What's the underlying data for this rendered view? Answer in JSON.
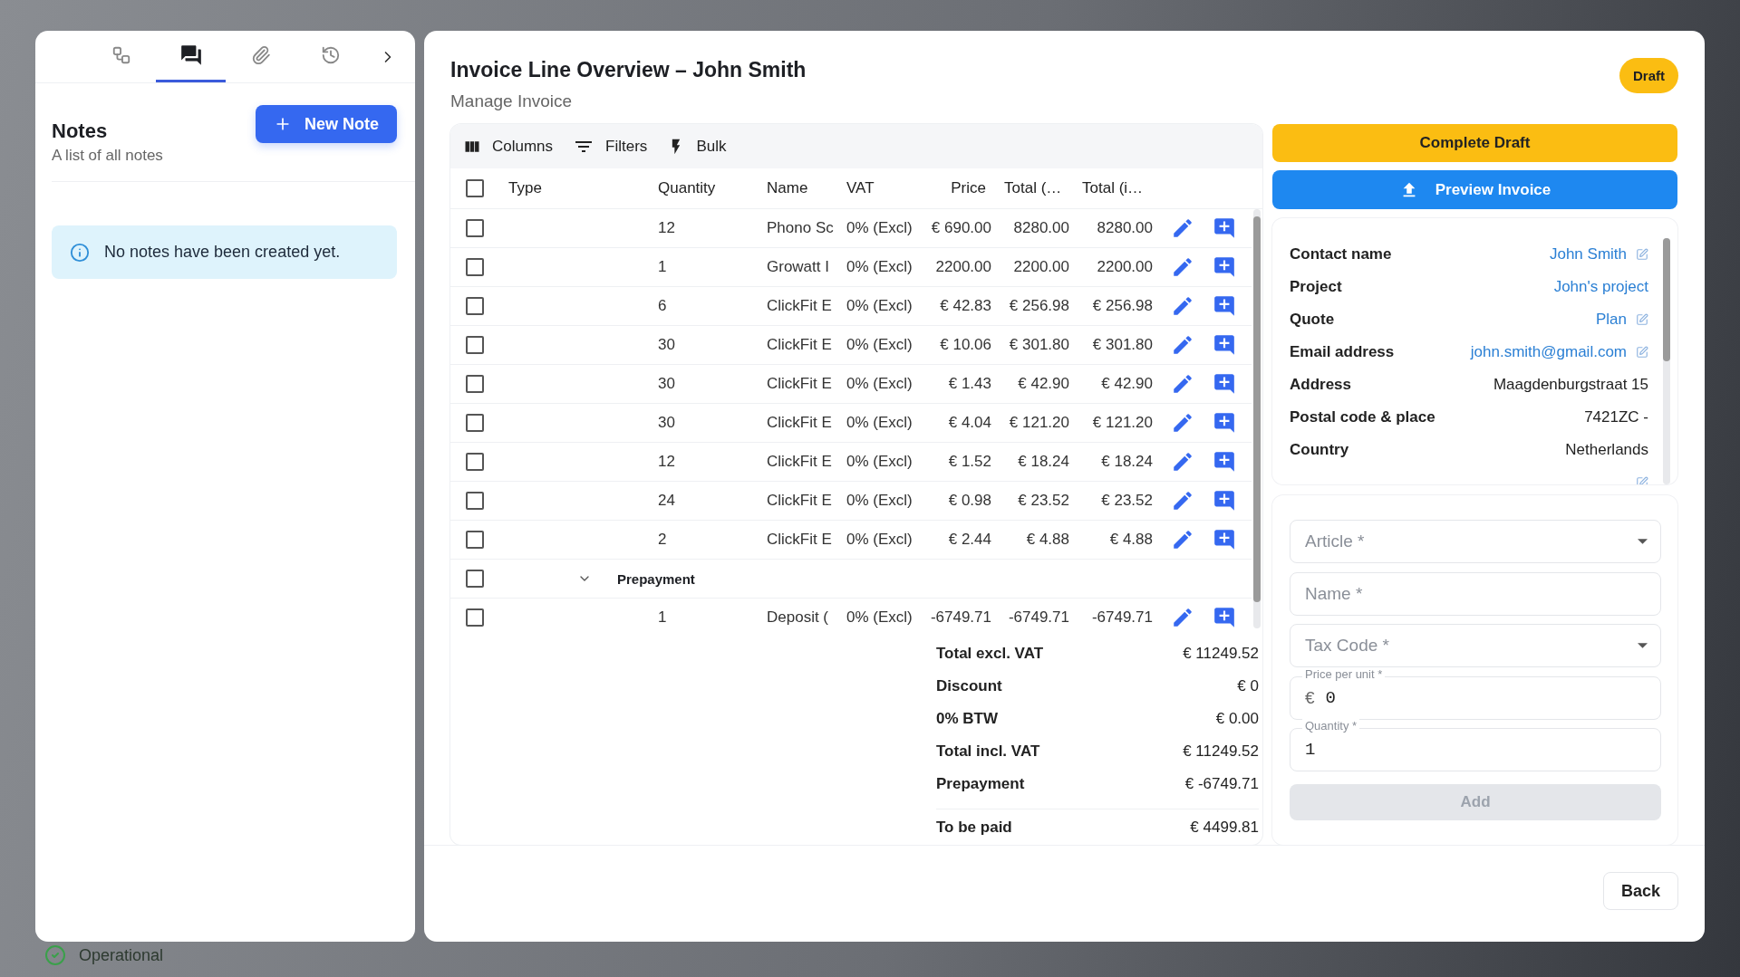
{
  "side_panel": {
    "tabs": [
      {
        "selected": false
      },
      {
        "selected": true
      },
      {
        "selected": false
      },
      {
        "selected": false
      }
    ],
    "title": "Notes",
    "new_button": "New Note",
    "subtitle": "A list of all notes",
    "empty_message": "No notes have been created yet."
  },
  "invoice": {
    "title": "Invoice Line Overview – John Smith",
    "subtitle": "Manage Invoice",
    "status_badge": "Draft"
  },
  "toolbar": [
    "Columns",
    "Filters",
    "Bulk"
  ],
  "table": {
    "header_checked": false,
    "columns": [
      "Type",
      "Quantity",
      "Name",
      "VAT",
      "Price",
      "Total (…",
      "Total (i…"
    ],
    "rows": [
      {
        "kind": "line",
        "checked": false,
        "quantity": "12",
        "name": "Phono Sc",
        "vat": "0% (Excl)",
        "price": "€ 690.00",
        "total_excl": "8280.00",
        "total_incl": "8280.00"
      },
      {
        "kind": "line",
        "checked": false,
        "quantity": "1",
        "name": "Growatt I",
        "vat": "0% (Excl)",
        "price": "2200.00",
        "total_excl": "2200.00",
        "total_incl": "2200.00"
      },
      {
        "kind": "line",
        "checked": false,
        "quantity": "6",
        "name": "ClickFit E",
        "vat": "0% (Excl)",
        "price": "€ 42.83",
        "total_excl": "€ 256.98",
        "total_incl": "€ 256.98"
      },
      {
        "kind": "line",
        "checked": false,
        "quantity": "30",
        "name": "ClickFit E",
        "vat": "0% (Excl)",
        "price": "€ 10.06",
        "total_excl": "€ 301.80",
        "total_incl": "€ 301.80"
      },
      {
        "kind": "line",
        "checked": false,
        "quantity": "30",
        "name": "ClickFit E",
        "vat": "0% (Excl)",
        "price": "€ 1.43",
        "total_excl": "€ 42.90",
        "total_incl": "€ 42.90"
      },
      {
        "kind": "line",
        "checked": false,
        "quantity": "30",
        "name": "ClickFit E",
        "vat": "0% (Excl)",
        "price": "€ 4.04",
        "total_excl": "€ 121.20",
        "total_incl": "€ 121.20"
      },
      {
        "kind": "line",
        "checked": false,
        "quantity": "12",
        "name": "ClickFit E",
        "vat": "0% (Excl)",
        "price": "€ 1.52",
        "total_excl": "€ 18.24",
        "total_incl": "€ 18.24"
      },
      {
        "kind": "line",
        "checked": false,
        "quantity": "24",
        "name": "ClickFit E",
        "vat": "0% (Excl)",
        "price": "€ 0.98",
        "total_excl": "€ 23.52",
        "total_incl": "€ 23.52"
      },
      {
        "kind": "line",
        "checked": false,
        "quantity": "2",
        "name": "ClickFit E",
        "vat": "0% (Excl)",
        "price": "€ 2.44",
        "total_excl": "€ 4.88",
        "total_incl": "€ 4.88"
      },
      {
        "kind": "group",
        "checked": false,
        "expanded": true,
        "label": "Prepayment"
      },
      {
        "kind": "line",
        "checked": false,
        "quantity": "1",
        "name": "Deposit (",
        "vat": "0% (Excl)",
        "price": "-6749.71",
        "total_excl": "-6749.71",
        "total_incl": "-6749.71"
      }
    ]
  },
  "totals": [
    {
      "kind": "line",
      "label": "Total excl. VAT",
      "value": "€ 11249.52"
    },
    {
      "kind": "line",
      "label": "Discount",
      "value": "€ 0"
    },
    {
      "kind": "line",
      "label": "0% BTW",
      "value": "€ 0.00"
    },
    {
      "kind": "line",
      "label": "Total incl. VAT",
      "value": "€ 11249.52"
    },
    {
      "kind": "line",
      "label": "Prepayment",
      "value": "€ -6749.71"
    },
    {
      "kind": "grand",
      "label": "To be paid",
      "value": "€ 4499.81"
    }
  ],
  "actions": {
    "complete": "Complete Draft",
    "preview": "Preview Invoice"
  },
  "details": [
    {
      "label": "Contact name",
      "value": "John Smith",
      "kind": "link",
      "editable": true
    },
    {
      "label": "Project",
      "value": "John's project",
      "kind": "link",
      "editable": false
    },
    {
      "label": "Quote",
      "value": "Plan",
      "kind": "link",
      "editable": true
    },
    {
      "label": "Email address",
      "value": "john.smith@gmail.com",
      "kind": "link",
      "editable": true
    },
    {
      "label": "Address",
      "value": "Maagdenburgstraat 15",
      "kind": "text",
      "editable": false
    },
    {
      "label": "Postal code & place",
      "value": "7421ZC -",
      "kind": "text",
      "editable": false
    },
    {
      "label": "Country",
      "value": "Netherlands",
      "kind": "text",
      "editable": false
    },
    {
      "kind": "text",
      "editable": true
    }
  ],
  "form": {
    "fields": [
      {
        "kind": "select",
        "placeholder": "Article *"
      },
      {
        "kind": "text",
        "placeholder": "Name *"
      },
      {
        "kind": "select",
        "placeholder": "Tax Code *"
      },
      {
        "kind": "number",
        "label": "Price per unit *",
        "prefix": "€",
        "value": "0"
      },
      {
        "kind": "number",
        "label": "Quantity *",
        "value": "1"
      }
    ],
    "add_button": {
      "label": "Add",
      "disabled": true
    }
  },
  "footer": {
    "back": "Back"
  },
  "background": {
    "status": "Operational"
  }
}
